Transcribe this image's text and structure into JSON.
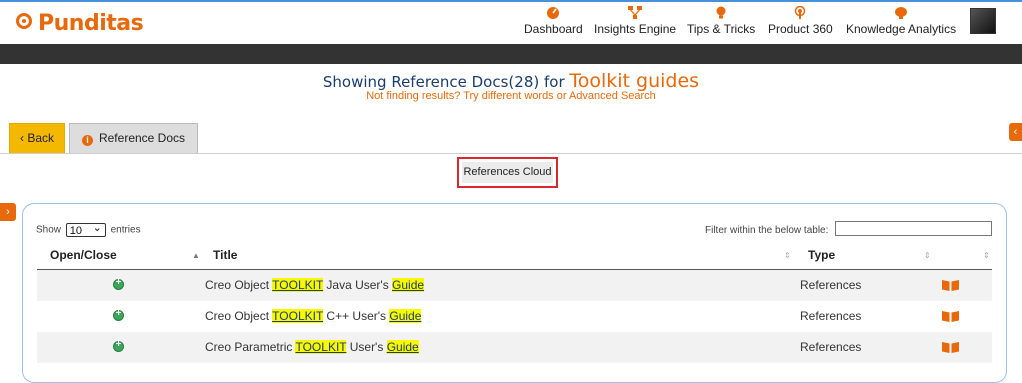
{
  "header": {
    "logo": "Punditas",
    "nav": [
      {
        "label": "Dashboard",
        "icon": "dashboard-icon"
      },
      {
        "label": "Insights Engine",
        "icon": "network-icon"
      },
      {
        "label": "Tips & Tricks",
        "icon": "lightbulb-icon"
      },
      {
        "label": "Product 360",
        "icon": "broadcast-icon"
      },
      {
        "label": "Knowledge Analytics",
        "icon": "brain-icon"
      }
    ]
  },
  "results": {
    "prefix": "Showing Reference Docs(28) for ",
    "query": "Toolkit guides",
    "hint": "Not finding results? Try different words or Advanced Search"
  },
  "tabs": {
    "back": "‹ Back",
    "reference_docs": "Reference Docs"
  },
  "cloud_button": "References Cloud",
  "table": {
    "show_prefix": "Show",
    "show_value": "10",
    "show_suffix": "entries",
    "filter_label": "Filter within the below table:",
    "columns": {
      "open_close": "Open/Close",
      "title": "Title",
      "type": "Type"
    },
    "rows": [
      {
        "pre": "Creo Object ",
        "mark1": "TOOLKIT",
        "mid": " Java User's ",
        "mark2": "Guide",
        "type": "References"
      },
      {
        "pre": "Creo Object ",
        "mark1": "TOOLKIT",
        "mid": " C++ User's ",
        "mark2": "Guide",
        "type": "References"
      },
      {
        "pre": "Creo Parametric ",
        "mark1": "TOOLKIT",
        "mid": " User's ",
        "mark2": "Guide",
        "type": "References"
      }
    ]
  },
  "colors": {
    "accent": "#e8690b",
    "highlight": "#f8f800",
    "navy": "#1b3d6d"
  }
}
